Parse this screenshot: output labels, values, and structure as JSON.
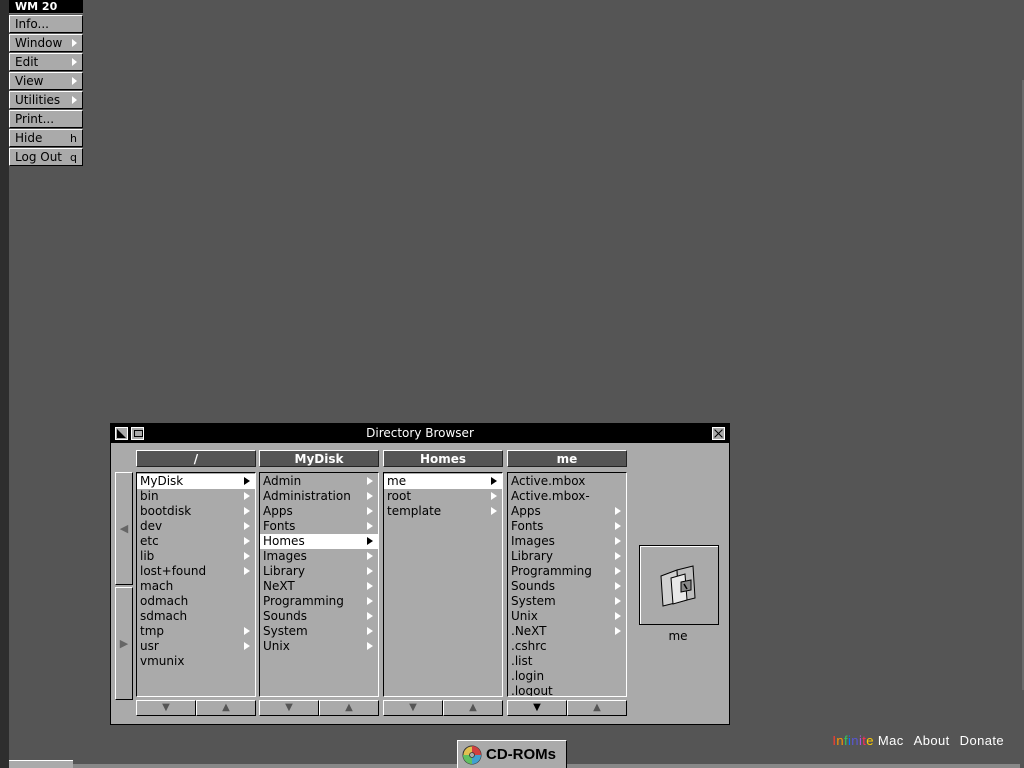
{
  "wm_menu": {
    "title": "WM 20",
    "items": [
      {
        "label": "Info...",
        "key": ""
      },
      {
        "label": "Window",
        "key": ""
      },
      {
        "label": "Edit",
        "key": ""
      },
      {
        "label": "View",
        "key": ""
      },
      {
        "label": "Utilities",
        "key": ""
      },
      {
        "label": "Print...",
        "key": ""
      },
      {
        "label": "Hide",
        "key": "h"
      },
      {
        "label": "Log Out",
        "key": "q"
      }
    ]
  },
  "browser": {
    "title": "Directory Browser",
    "columns": [
      {
        "header": "/",
        "items": [
          {
            "name": "MyDisk",
            "dir": true,
            "selected": true
          },
          {
            "name": "bin",
            "dir": true
          },
          {
            "name": "bootdisk",
            "dir": true
          },
          {
            "name": "dev",
            "dir": true
          },
          {
            "name": "etc",
            "dir": true
          },
          {
            "name": "lib",
            "dir": true
          },
          {
            "name": "lost+found",
            "dir": true
          },
          {
            "name": "mach",
            "dir": false
          },
          {
            "name": "odmach",
            "dir": false
          },
          {
            "name": "sdmach",
            "dir": false
          },
          {
            "name": "tmp",
            "dir": true
          },
          {
            "name": "usr",
            "dir": true
          },
          {
            "name": "vmunix",
            "dir": false
          }
        ]
      },
      {
        "header": "MyDisk",
        "items": [
          {
            "name": "Admin",
            "dir": true
          },
          {
            "name": "Administration",
            "dir": true
          },
          {
            "name": "Apps",
            "dir": true
          },
          {
            "name": "Fonts",
            "dir": true
          },
          {
            "name": "Homes",
            "dir": true,
            "selected": true
          },
          {
            "name": "Images",
            "dir": true
          },
          {
            "name": "Library",
            "dir": true
          },
          {
            "name": "NeXT",
            "dir": true
          },
          {
            "name": "Programming",
            "dir": true
          },
          {
            "name": "Sounds",
            "dir": true
          },
          {
            "name": "System",
            "dir": true
          },
          {
            "name": "Unix",
            "dir": true
          }
        ]
      },
      {
        "header": "Homes",
        "items": [
          {
            "name": "me",
            "dir": true,
            "selected": true
          },
          {
            "name": "root",
            "dir": true
          },
          {
            "name": "template",
            "dir": true
          }
        ]
      },
      {
        "header": "me",
        "items": [
          {
            "name": "Active.mbox",
            "dir": false
          },
          {
            "name": "Active.mbox-",
            "dir": false
          },
          {
            "name": "Apps",
            "dir": true
          },
          {
            "name": "Fonts",
            "dir": true
          },
          {
            "name": "Images",
            "dir": true
          },
          {
            "name": "Library",
            "dir": true
          },
          {
            "name": "Programming",
            "dir": true
          },
          {
            "name": "Sounds",
            "dir": true
          },
          {
            "name": "System",
            "dir": true
          },
          {
            "name": "Unix",
            "dir": true
          },
          {
            "name": ".NeXT",
            "dir": true
          },
          {
            "name": ".cshrc",
            "dir": false
          },
          {
            "name": ".list",
            "dir": false
          },
          {
            "name": ".login",
            "dir": false
          },
          {
            "name": ".logout",
            "dir": false
          }
        ]
      }
    ],
    "selected_icon_label": "me"
  },
  "shelf": {
    "cdrom_label": "CD-ROMs"
  },
  "footer": {
    "brand_infinite": "Infinite",
    "brand_mac": "Mac",
    "about": "About",
    "donate": "Donate"
  },
  "colors": {
    "desktop": "#555555",
    "panel": "#aaaaaa",
    "infinite_letters": [
      "#ff3b30",
      "#ff9500",
      "#34c759",
      "#007aff",
      "#5856d6",
      "#af52de",
      "#ff2d55",
      "#ffcc00"
    ]
  }
}
